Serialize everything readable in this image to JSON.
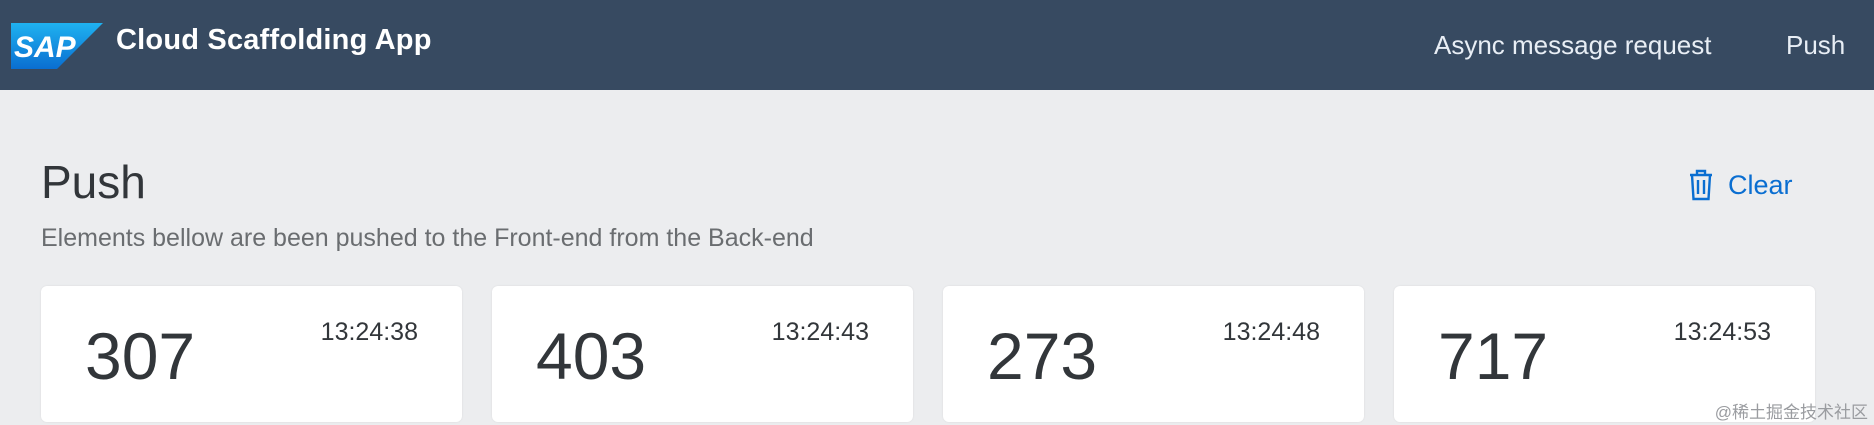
{
  "shellbar": {
    "logo_text": "SAP",
    "title": "Cloud Scaffolding App",
    "nav": [
      {
        "label": "Async message request"
      },
      {
        "label": "Push"
      }
    ],
    "background_color": "#374a61"
  },
  "page": {
    "title": "Push",
    "subtitle": "Elements bellow are been pushed to the Front-end from the Back-end",
    "clear_label": "Clear",
    "clear_icon": "trash-icon",
    "accent_color": "#0a6ed1"
  },
  "cards": [
    {
      "value": "307",
      "time": "13:24:38"
    },
    {
      "value": "403",
      "time": "13:24:43"
    },
    {
      "value": "273",
      "time": "13:24:48"
    },
    {
      "value": "717",
      "time": "13:24:53"
    }
  ],
  "watermark": "@稀土掘金技术社区"
}
